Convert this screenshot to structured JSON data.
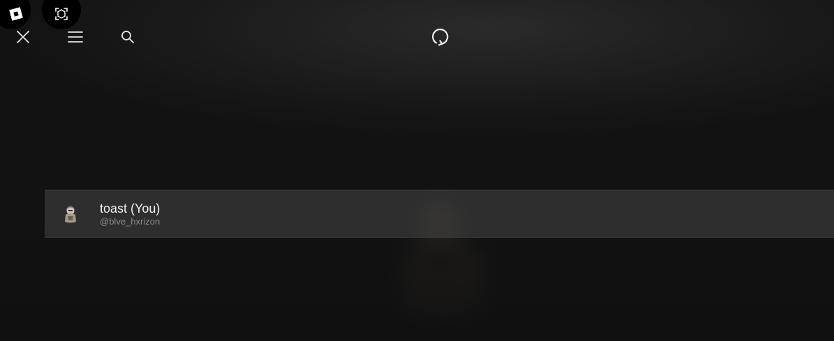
{
  "toolbar": {
    "icons": [
      "roblox-logo-icon",
      "camera-icon",
      "close-icon",
      "menu-icon",
      "search-icon",
      "refresh-icon"
    ]
  },
  "players": [
    {
      "display_name": "toast (You)",
      "username": "@blve_hxrizon",
      "avatar_icon": "avatar-icon"
    }
  ],
  "colors": {
    "background": "#151515",
    "row_background": "#3a3a3a",
    "name_text": "#f2f2f2",
    "username_text": "#8a8a8a",
    "icon": "#ffffff"
  }
}
